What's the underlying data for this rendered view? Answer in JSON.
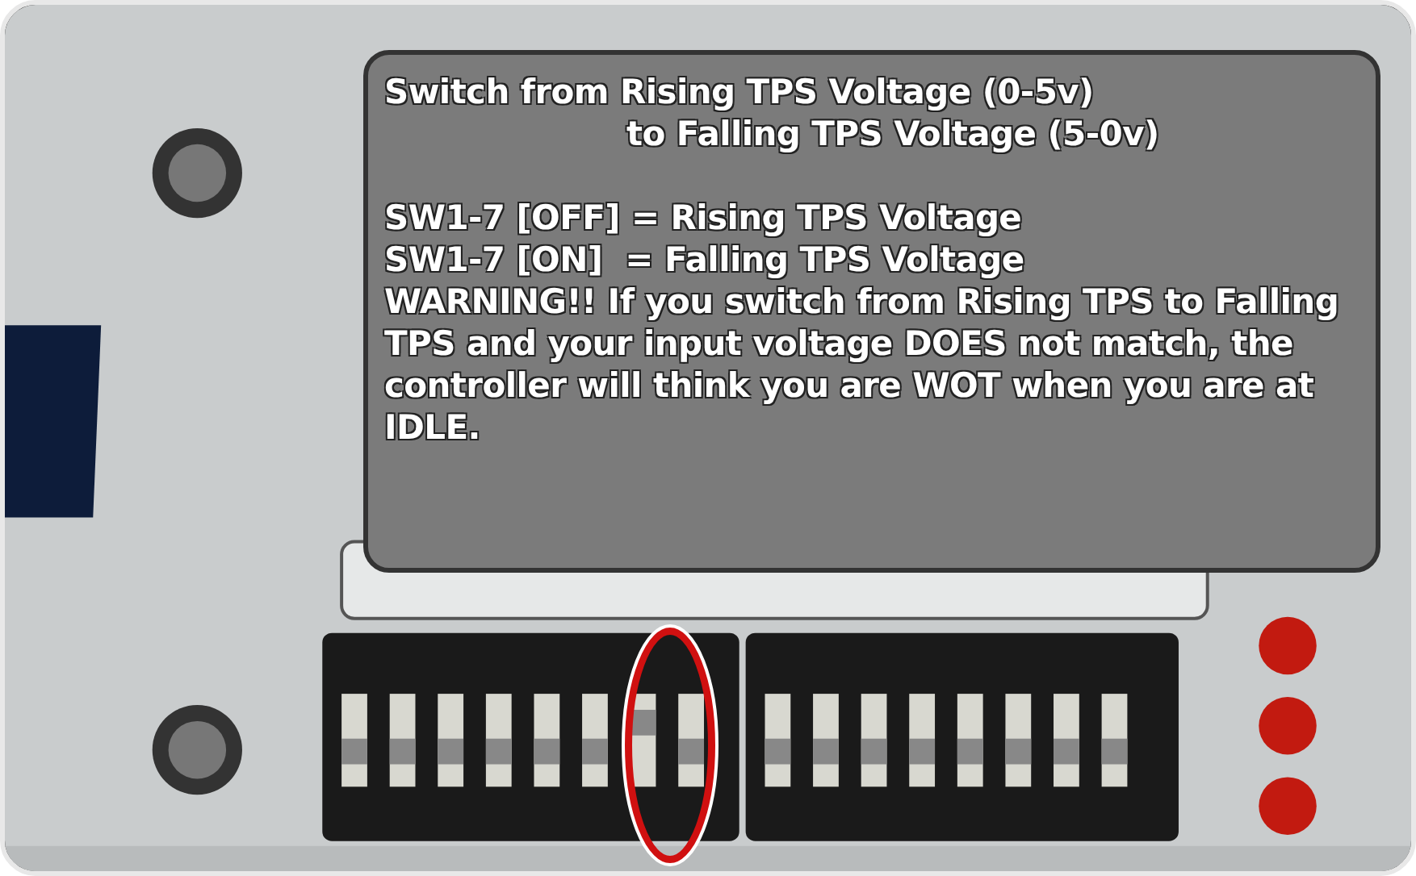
{
  "tooltip": {
    "title_lines": [
      "Switch from Rising TPS Voltage (0-5v)",
      "to Falling TPS Voltage (5-0v)"
    ],
    "settings": [
      "SW1-7 [OFF] = Rising TPS Voltage",
      "SW1-7 [ON]  = Falling TPS Voltage"
    ],
    "warning": "WARNING!!  If you switch from Rising TPS to Falling TPS and your input voltage DOES not match, the controller will think you are WOT when you are at IDLE."
  },
  "highlight": {
    "color": "#d01010"
  }
}
